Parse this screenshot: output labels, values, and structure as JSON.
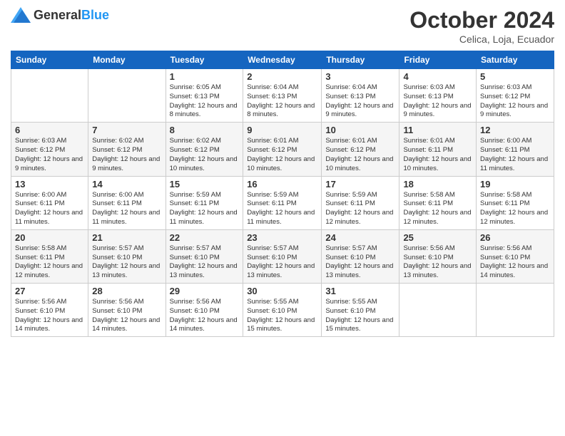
{
  "header": {
    "logo_general": "General",
    "logo_blue": "Blue",
    "month_title": "October 2024",
    "subtitle": "Celica, Loja, Ecuador"
  },
  "weekdays": [
    "Sunday",
    "Monday",
    "Tuesday",
    "Wednesday",
    "Thursday",
    "Friday",
    "Saturday"
  ],
  "weeks": [
    [
      {
        "day": "",
        "info": ""
      },
      {
        "day": "",
        "info": ""
      },
      {
        "day": "1",
        "info": "Sunrise: 6:05 AM\nSunset: 6:13 PM\nDaylight: 12 hours and 8 minutes."
      },
      {
        "day": "2",
        "info": "Sunrise: 6:04 AM\nSunset: 6:13 PM\nDaylight: 12 hours and 8 minutes."
      },
      {
        "day": "3",
        "info": "Sunrise: 6:04 AM\nSunset: 6:13 PM\nDaylight: 12 hours and 9 minutes."
      },
      {
        "day": "4",
        "info": "Sunrise: 6:03 AM\nSunset: 6:13 PM\nDaylight: 12 hours and 9 minutes."
      },
      {
        "day": "5",
        "info": "Sunrise: 6:03 AM\nSunset: 6:12 PM\nDaylight: 12 hours and 9 minutes."
      }
    ],
    [
      {
        "day": "6",
        "info": "Sunrise: 6:03 AM\nSunset: 6:12 PM\nDaylight: 12 hours and 9 minutes."
      },
      {
        "day": "7",
        "info": "Sunrise: 6:02 AM\nSunset: 6:12 PM\nDaylight: 12 hours and 9 minutes."
      },
      {
        "day": "8",
        "info": "Sunrise: 6:02 AM\nSunset: 6:12 PM\nDaylight: 12 hours and 10 minutes."
      },
      {
        "day": "9",
        "info": "Sunrise: 6:01 AM\nSunset: 6:12 PM\nDaylight: 12 hours and 10 minutes."
      },
      {
        "day": "10",
        "info": "Sunrise: 6:01 AM\nSunset: 6:12 PM\nDaylight: 12 hours and 10 minutes."
      },
      {
        "day": "11",
        "info": "Sunrise: 6:01 AM\nSunset: 6:11 PM\nDaylight: 12 hours and 10 minutes."
      },
      {
        "day": "12",
        "info": "Sunrise: 6:00 AM\nSunset: 6:11 PM\nDaylight: 12 hours and 11 minutes."
      }
    ],
    [
      {
        "day": "13",
        "info": "Sunrise: 6:00 AM\nSunset: 6:11 PM\nDaylight: 12 hours and 11 minutes."
      },
      {
        "day": "14",
        "info": "Sunrise: 6:00 AM\nSunset: 6:11 PM\nDaylight: 12 hours and 11 minutes."
      },
      {
        "day": "15",
        "info": "Sunrise: 5:59 AM\nSunset: 6:11 PM\nDaylight: 12 hours and 11 minutes."
      },
      {
        "day": "16",
        "info": "Sunrise: 5:59 AM\nSunset: 6:11 PM\nDaylight: 12 hours and 11 minutes."
      },
      {
        "day": "17",
        "info": "Sunrise: 5:59 AM\nSunset: 6:11 PM\nDaylight: 12 hours and 12 minutes."
      },
      {
        "day": "18",
        "info": "Sunrise: 5:58 AM\nSunset: 6:11 PM\nDaylight: 12 hours and 12 minutes."
      },
      {
        "day": "19",
        "info": "Sunrise: 5:58 AM\nSunset: 6:11 PM\nDaylight: 12 hours and 12 minutes."
      }
    ],
    [
      {
        "day": "20",
        "info": "Sunrise: 5:58 AM\nSunset: 6:11 PM\nDaylight: 12 hours and 12 minutes."
      },
      {
        "day": "21",
        "info": "Sunrise: 5:57 AM\nSunset: 6:10 PM\nDaylight: 12 hours and 13 minutes."
      },
      {
        "day": "22",
        "info": "Sunrise: 5:57 AM\nSunset: 6:10 PM\nDaylight: 12 hours and 13 minutes."
      },
      {
        "day": "23",
        "info": "Sunrise: 5:57 AM\nSunset: 6:10 PM\nDaylight: 12 hours and 13 minutes."
      },
      {
        "day": "24",
        "info": "Sunrise: 5:57 AM\nSunset: 6:10 PM\nDaylight: 12 hours and 13 minutes."
      },
      {
        "day": "25",
        "info": "Sunrise: 5:56 AM\nSunset: 6:10 PM\nDaylight: 12 hours and 13 minutes."
      },
      {
        "day": "26",
        "info": "Sunrise: 5:56 AM\nSunset: 6:10 PM\nDaylight: 12 hours and 14 minutes."
      }
    ],
    [
      {
        "day": "27",
        "info": "Sunrise: 5:56 AM\nSunset: 6:10 PM\nDaylight: 12 hours and 14 minutes."
      },
      {
        "day": "28",
        "info": "Sunrise: 5:56 AM\nSunset: 6:10 PM\nDaylight: 12 hours and 14 minutes."
      },
      {
        "day": "29",
        "info": "Sunrise: 5:56 AM\nSunset: 6:10 PM\nDaylight: 12 hours and 14 minutes."
      },
      {
        "day": "30",
        "info": "Sunrise: 5:55 AM\nSunset: 6:10 PM\nDaylight: 12 hours and 15 minutes."
      },
      {
        "day": "31",
        "info": "Sunrise: 5:55 AM\nSunset: 6:10 PM\nDaylight: 12 hours and 15 minutes."
      },
      {
        "day": "",
        "info": ""
      },
      {
        "day": "",
        "info": ""
      }
    ]
  ]
}
